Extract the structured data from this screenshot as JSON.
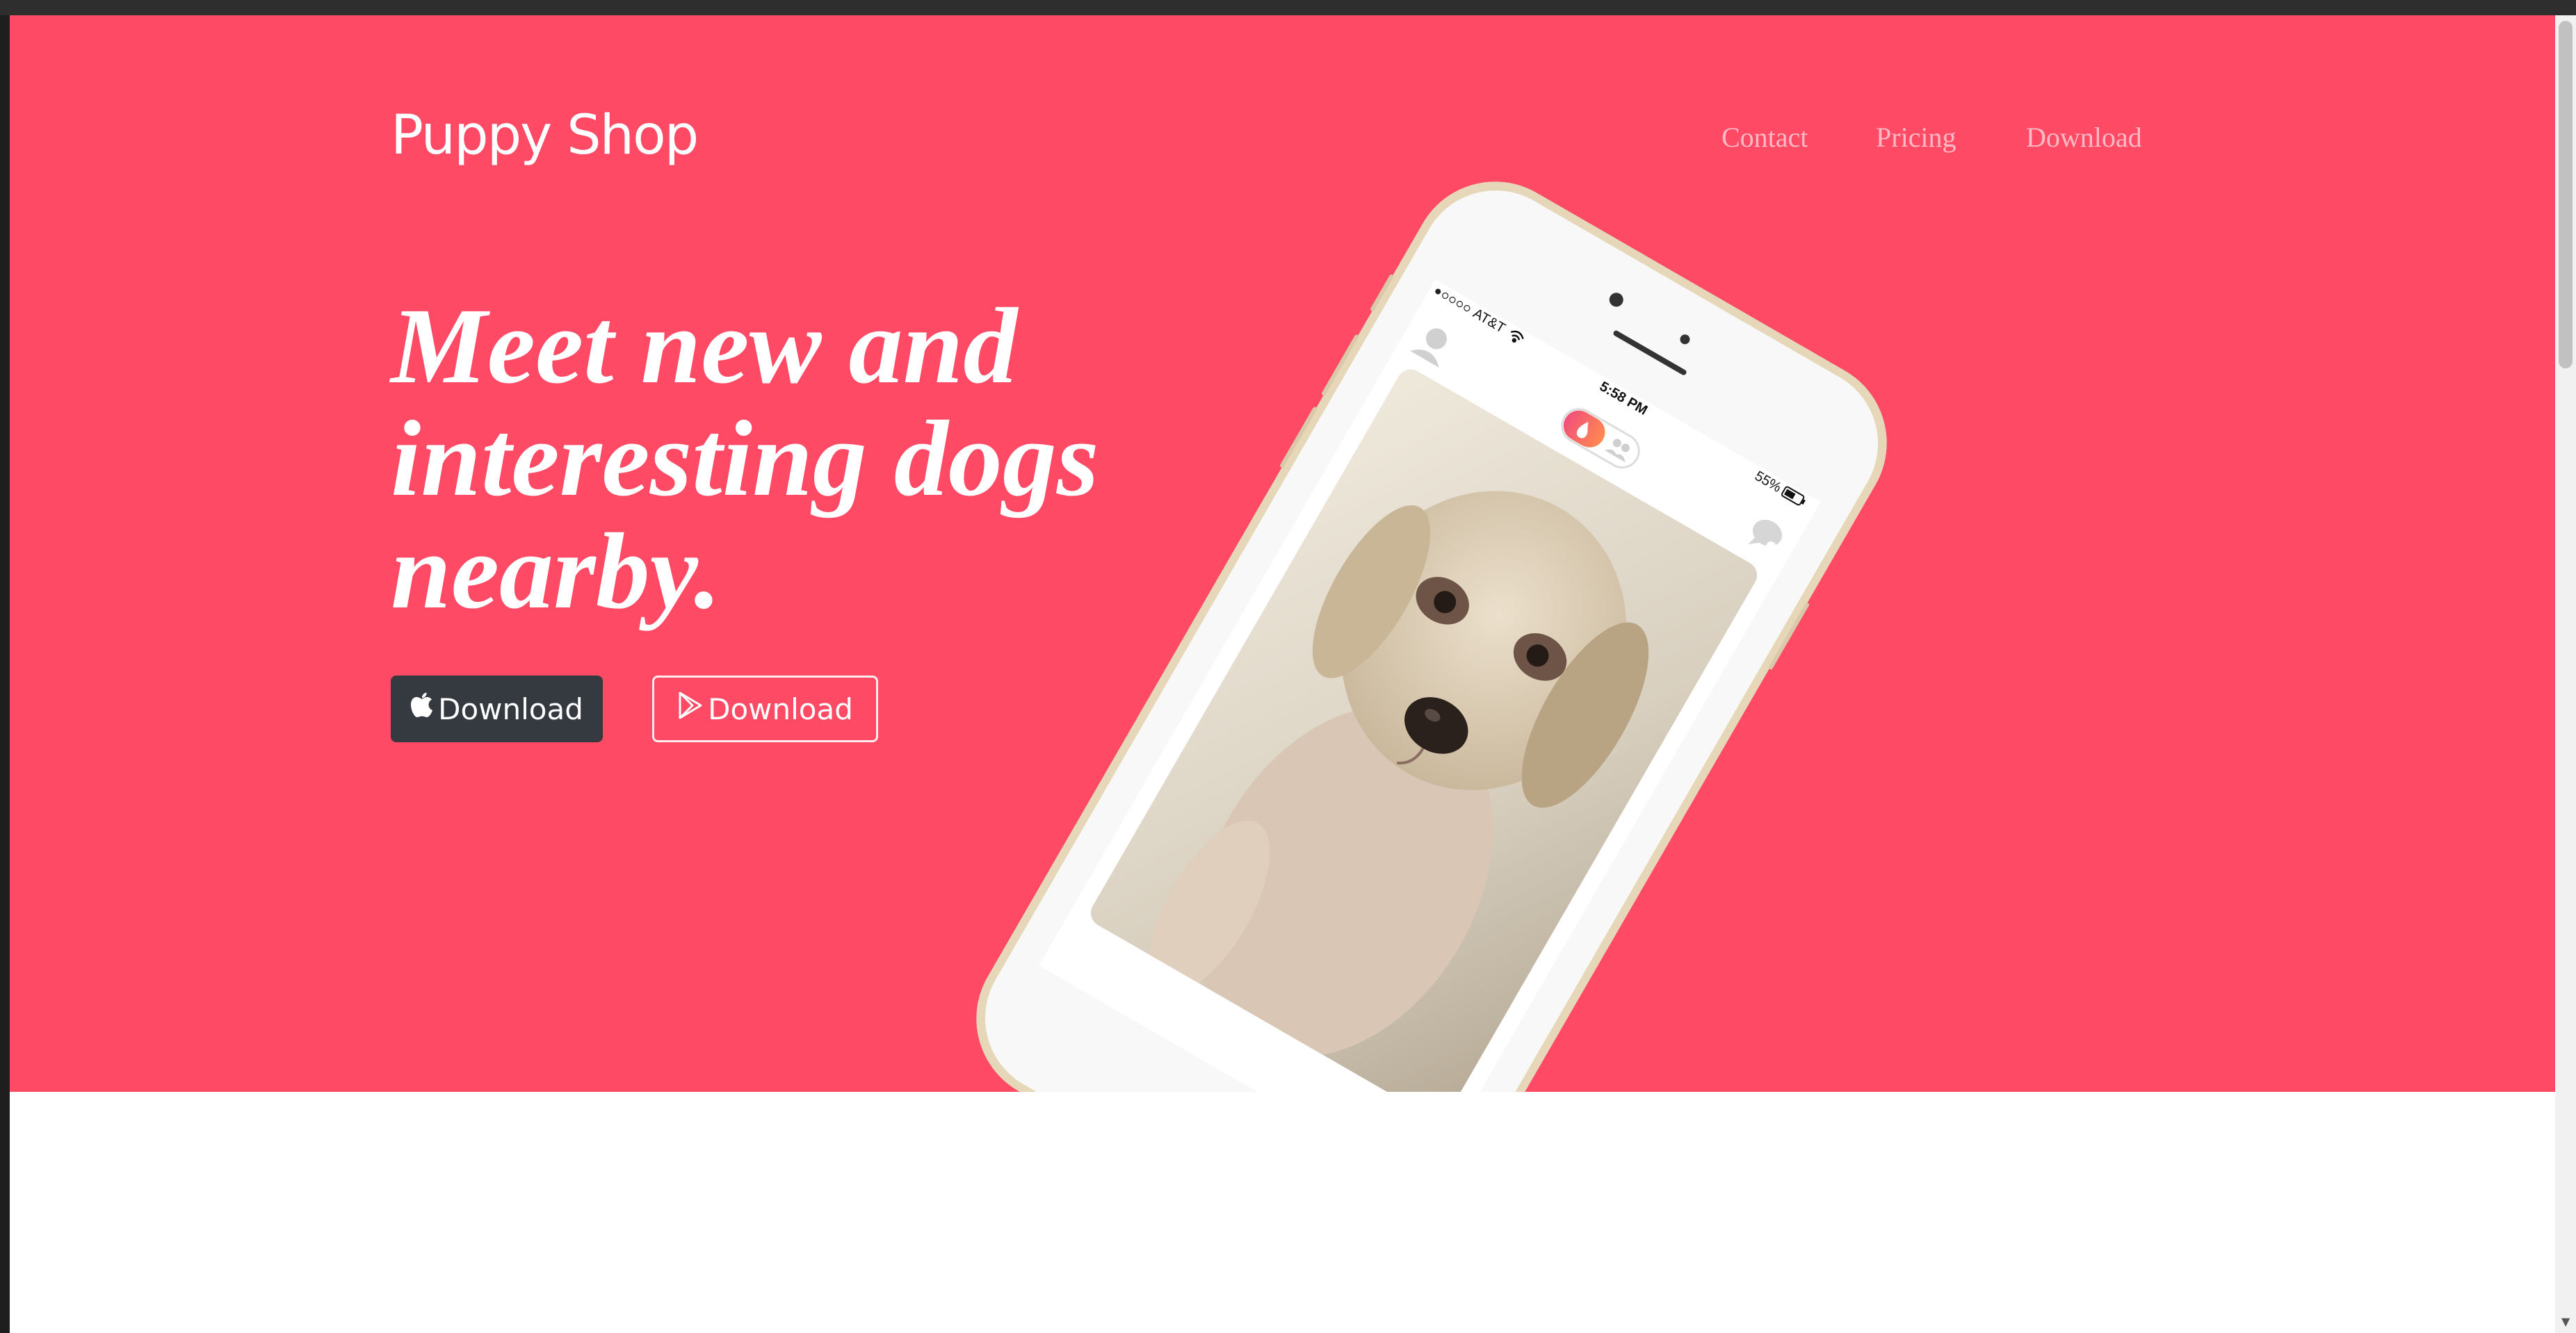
{
  "brand": {
    "name": "Puppy Shop"
  },
  "nav": {
    "links": [
      "Contact",
      "Pricing",
      "Download"
    ]
  },
  "hero": {
    "headline": "Meet new and interesting dogs nearby.",
    "apple_button_label": "Download",
    "play_button_label": "Download"
  },
  "phone": {
    "carrier": "AT&T",
    "time": "5:58 PM",
    "battery": "55%"
  },
  "colors": {
    "accent": "#ff4a66",
    "dark_button": "#343a40"
  },
  "icons": [
    "apple-icon",
    "play-store-icon",
    "profile-icon",
    "flame-icon",
    "group-icon",
    "chat-icon",
    "wifi-icon"
  ]
}
